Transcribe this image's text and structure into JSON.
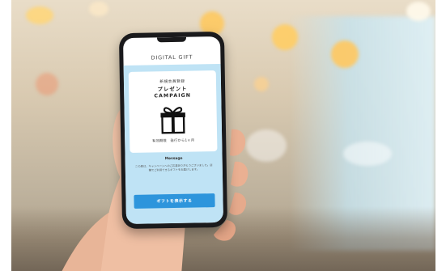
{
  "app": {
    "header_title": "DIGITAL GIFT"
  },
  "card": {
    "kicker": "新規会員登録",
    "title_jp": "プレゼント",
    "title_en": "CAMPAIGN",
    "gift_icon": "gift-icon",
    "note": "有効期限　発行から1ヶ月"
  },
  "message": {
    "label": "Message",
    "body": "この度は、キャンペーンへのご応募ありがとうございました。店舗でご利用できるギフトをお届けします。"
  },
  "cta": {
    "label": "ギフトを表示する"
  },
  "colors": {
    "hero_bg": "#bfe3f5",
    "cta_bg": "#2d95dc"
  }
}
